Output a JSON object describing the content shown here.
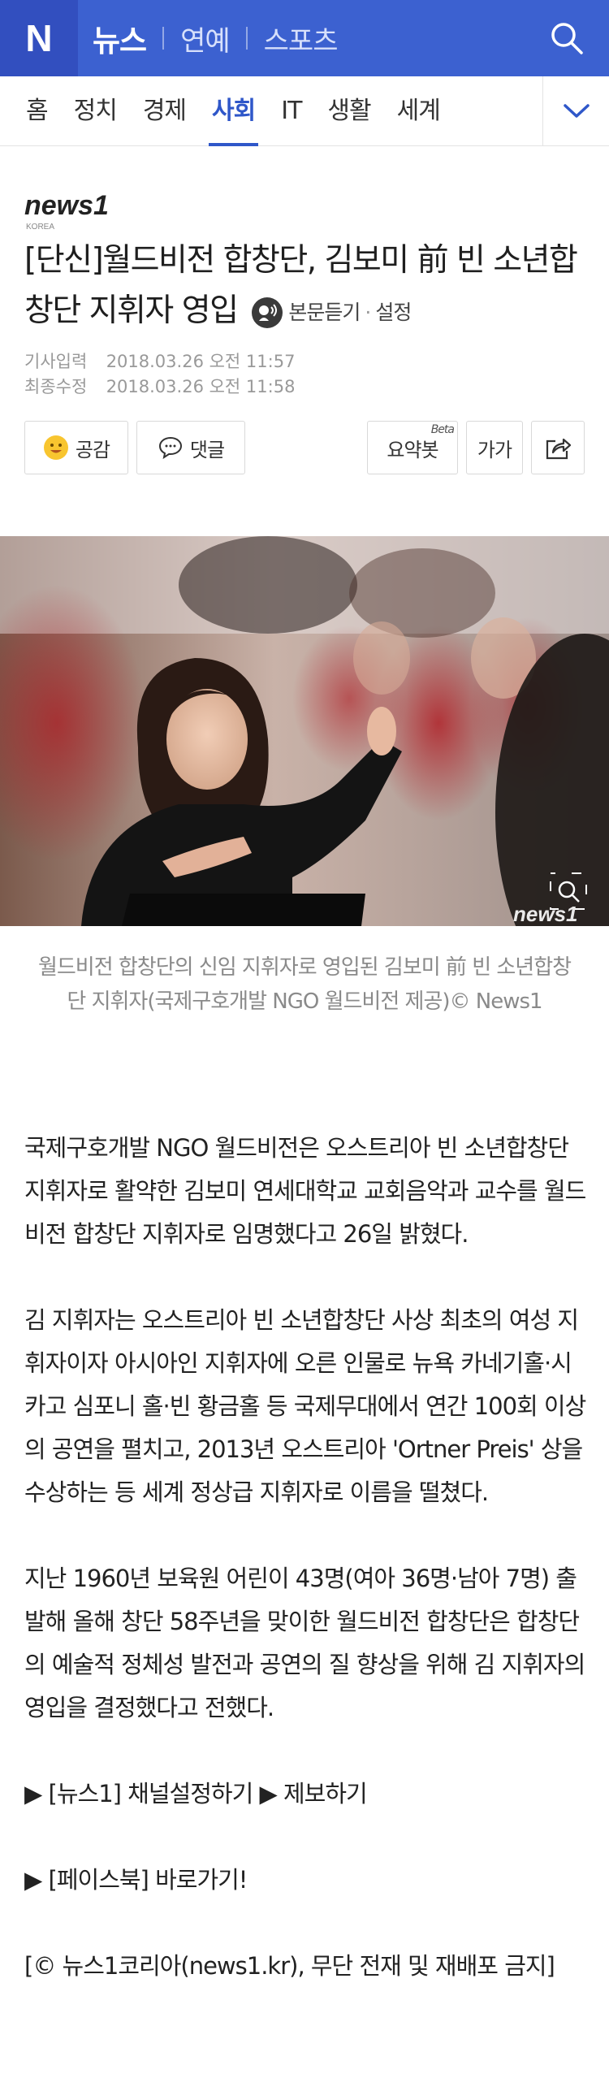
{
  "header": {
    "logo_letter": "N",
    "nav": [
      "뉴스",
      "연예",
      "스포츠"
    ]
  },
  "categories": {
    "tabs": [
      "홈",
      "정치",
      "경제",
      "사회",
      "IT",
      "생활",
      "세계"
    ],
    "active": "사회"
  },
  "article": {
    "press": "news1",
    "press_sub": "KOREA",
    "title": "[단신]월드비전 합창단, 김보미 前 빈 소년합창단 지휘자 영입",
    "tts_label": "본문듣기",
    "settings_label": "설정",
    "dates": [
      {
        "label": "기사입력",
        "value": "2018.03.26 오전 11:57"
      },
      {
        "label": "최종수정",
        "value": "2018.03.26 오전 11:58"
      }
    ],
    "actions": {
      "like": "공감",
      "comment": "댓글",
      "summary": "요약봇",
      "summary_badge": "Beta",
      "font": "가가"
    },
    "photo_watermark": "news1",
    "caption": "월드비전 합창단의 신임 지휘자로 영입된 김보미 前 빈 소년합창단 지휘자(국제구호개발 NGO 월드비전 제공)© News1",
    "paragraphs": [
      "국제구호개발 NGO 월드비전은 오스트리아 빈 소년합창단 지휘자로 활약한 김보미 연세대학교 교회음악과 교수를 월드비전 합창단 지휘자로 임명했다고 26일 밝혔다.",
      "김 지휘자는 오스트리아 빈 소년합창단 사상 최초의 여성 지휘자이자 아시아인 지휘자에 오른 인물로 뉴욕 카네기홀·시카고 심포니 홀·빈 황금홀 등 국제무대에서 연간 100회 이상의 공연을 펼치고, 2013년 오스트리아 'Ortner Preis' 상을 수상하는 등 세계 정상급 지휘자로 이름을 떨쳤다.",
      "지난 1960년 보육원 어린이 43명(여아 36명·남아 7명) 출발해 올해 창단 58주년을 맞이한 월드비전 합창단은 합창단의 예술적 정체성 발전과 공연의 질 향상을 위해 김 지휘자의 영입을 결정했다고 전했다.",
      "▶ [뉴스1] 채널설정하기 ▶ 제보하기",
      "▶ [페이스북] 바로가기!",
      "[© 뉴스1코리아(news1.kr), 무단 전재 및 재배포 금지]"
    ]
  },
  "colors": {
    "header_blue": "#3c61d0",
    "accent_blue": "#2f57c9",
    "press_red": "#e8471b"
  },
  "icons": [
    "search-icon",
    "chevron-down-icon",
    "tts-icon",
    "smile-icon",
    "comment-bubble-icon",
    "share-icon",
    "zoom-icon"
  ]
}
